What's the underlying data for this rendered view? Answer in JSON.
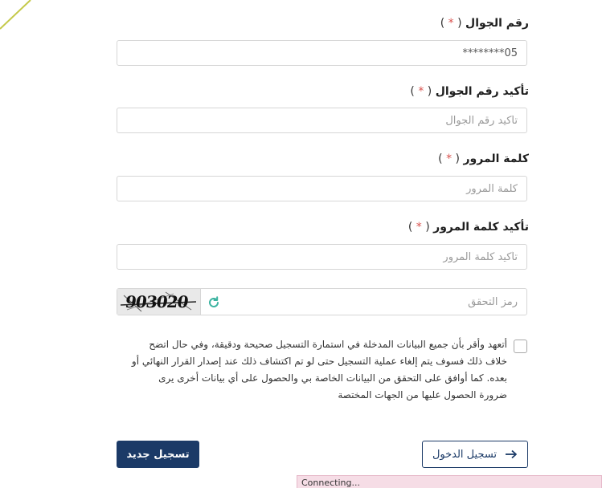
{
  "fields": {
    "mobile": {
      "label": "رقم الجوال",
      "required_open": " ( ",
      "required_star": "*",
      "required_close": " )",
      "value": "05********"
    },
    "mobile_confirm": {
      "label": "تأكيد رقم الجوال",
      "required_open": " ( ",
      "required_star": "*",
      "required_close": " )",
      "placeholder": "تأكيد رقم الجوال"
    },
    "password": {
      "label": "كلمة المرور",
      "required_open": " ( ",
      "required_star": "*",
      "required_close": " )",
      "placeholder": "كلمة المرور"
    },
    "password_confirm": {
      "label": "تأكيد كلمة المرور",
      "required_open": " ( ",
      "required_star": "*",
      "required_close": " )",
      "placeholder": "تأكيد كلمة المرور"
    }
  },
  "captcha": {
    "image_text": "903020",
    "placeholder": "رمز التحقق",
    "refresh_icon": "refresh-icon"
  },
  "consent": {
    "text": "أتعهد وأقر بأن جميع البيانات المدخلة في استمارة التسجيل صحيحة ودقيقة، وفي حال اتضح خلاف ذلك فسوف يتم إلغاء عملية التسجيل حتى لو تم اكتشاف ذلك عند إصدار القرار النهائي أو بعده. كما أوافق على التحقق من البيانات الخاصة بي والحصول على أي بيانات أخرى يرى ضرورة الحصول عليها من الجهات المختصة",
    "checked": false
  },
  "buttons": {
    "register": "تسجيل جديد",
    "login": "تسجيل الدخول",
    "login_icon": "arrow-right-icon"
  },
  "status_bar": {
    "text": "Connecting..."
  },
  "colors": {
    "primary": "#1b3a67",
    "required_star": "#d9534f",
    "refresh": "#3bb3a0",
    "accent_line": "#c5c94a",
    "status_bg": "#f6dde6"
  }
}
